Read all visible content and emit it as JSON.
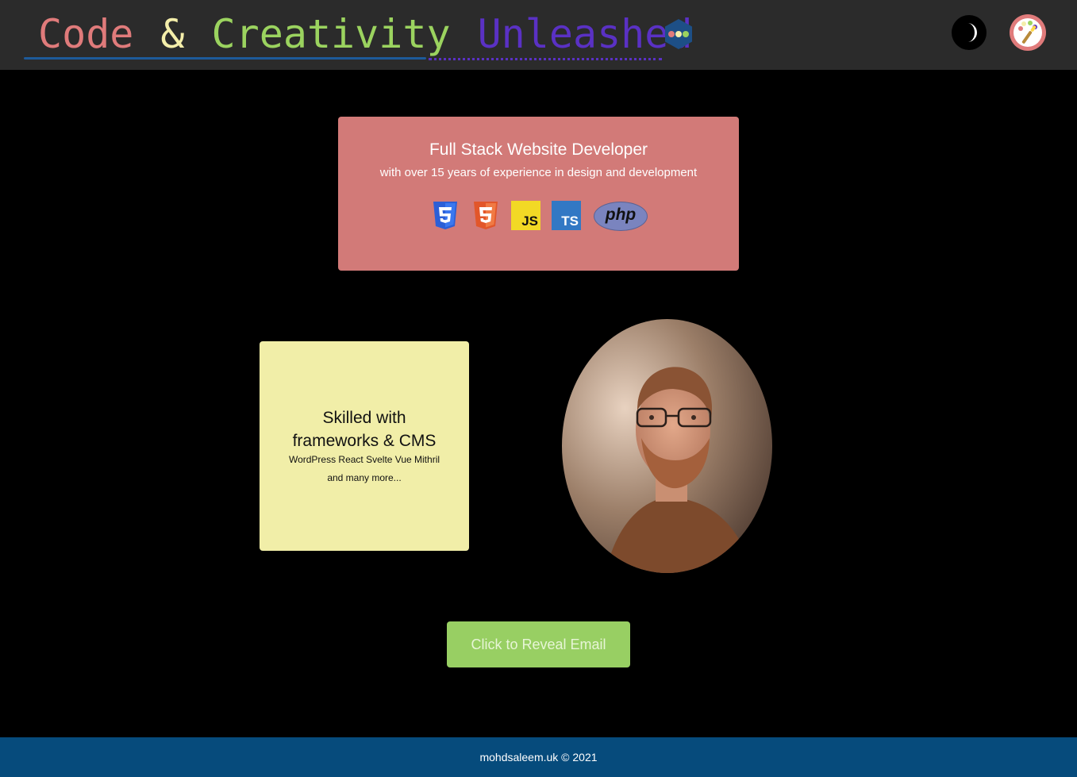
{
  "header": {
    "brand_words": [
      "Code",
      "&",
      "Creativity",
      "Unleashed"
    ],
    "icons": {
      "logo": "hexagon-dots-logo-icon",
      "theme": "moon-icon",
      "palette": "paint-palette-icon"
    }
  },
  "intro": {
    "title": "Full Stack Website Developer",
    "subtitle": "with over 15 years of experience in design and development",
    "tech_icons": [
      "css3-icon",
      "html5-icon",
      "javascript-icon",
      "typescript-icon",
      "php-icon"
    ],
    "tech_labels": {
      "js": "JS",
      "ts": "TS",
      "php": "php"
    }
  },
  "skills": {
    "title_line1": "Skilled with",
    "title_line2": "frameworks & CMS",
    "list": "WordPress React Svelte Vue Mithril",
    "more": "and many more..."
  },
  "email_button": {
    "label": "Click to Reveal Email"
  },
  "footer": {
    "text": "mohdsaleem.uk © 2021"
  },
  "colors": {
    "header_bg": "#2b2b2b",
    "intro_card": "#d27a78",
    "skills_card": "#f1eea8",
    "email_button": "#98cf63",
    "footer_bg": "#064b7c",
    "brand_red": "#e07b7b",
    "brand_yellow": "#f4eeaa",
    "brand_green": "#9bd35f",
    "brand_purple": "#5a31c4"
  }
}
